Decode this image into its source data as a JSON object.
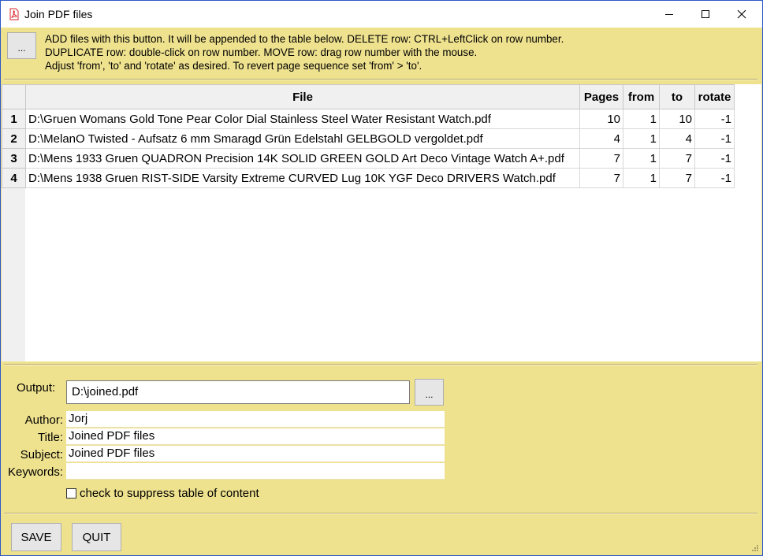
{
  "window": {
    "title": "Join PDF files",
    "minimize_glyph": "─",
    "maximize_glyph": "☐",
    "close_glyph": "✕"
  },
  "top": {
    "add_button_label": "...",
    "instructions": [
      "ADD files with this button. It will be appended to the table below. DELETE row: CTRL+LeftClick on row number.",
      "DUPLICATE row: double-click on row number. MOVE row: drag row number with the mouse.",
      "Adjust 'from', 'to' and 'rotate' as desired. To revert page sequence set 'from' > 'to'."
    ]
  },
  "table": {
    "headers": [
      "File",
      "Pages",
      "from",
      "to",
      "rotate"
    ],
    "rows": [
      {
        "n": "1",
        "file": "D:\\Gruen Womans Gold Tone Pear Color Dial Stainless Steel Water Resistant Watch.pdf",
        "pages": "10",
        "from": "1",
        "to": "10",
        "rotate": "-1"
      },
      {
        "n": "2",
        "file": "D:\\MelanO Twisted - Aufsatz 6 mm Smaragd Grün  Edelstahl GELBGOLD vergoldet.pdf",
        "pages": "4",
        "from": "1",
        "to": "4",
        "rotate": "-1"
      },
      {
        "n": "3",
        "file": "D:\\Mens 1933 Gruen QUADRON Precision 14K SOLID GREEN GOLD Art Deco Vintage Watch A+.pdf",
        "pages": "7",
        "from": "1",
        "to": "7",
        "rotate": "-1"
      },
      {
        "n": "4",
        "file": "D:\\Mens 1938 Gruen RIST-SIDE Varsity Extreme CURVED Lug 10K YGF Deco DRIVERS Watch.pdf",
        "pages": "7",
        "from": "1",
        "to": "7",
        "rotate": "-1"
      }
    ]
  },
  "form": {
    "output_label": "Output:",
    "output_value": "D:\\joined.pdf",
    "browse_label": "...",
    "author_label": "Author:",
    "author_value": "Jorj",
    "title_label": "Title:",
    "title_value": "Joined PDF files",
    "subject_label": "Subject:",
    "subject_value": "Joined PDF files",
    "keywords_label": "Keywords:",
    "keywords_value": "",
    "checkbox_label": "check to suppress table of content",
    "checkbox_checked": false
  },
  "buttons": {
    "save": "SAVE",
    "quit": "QUIT"
  },
  "colors": {
    "panel_bg": "#efe28f",
    "window_border": "#2b57c8",
    "pdf_icon_red": "#d9272e"
  }
}
